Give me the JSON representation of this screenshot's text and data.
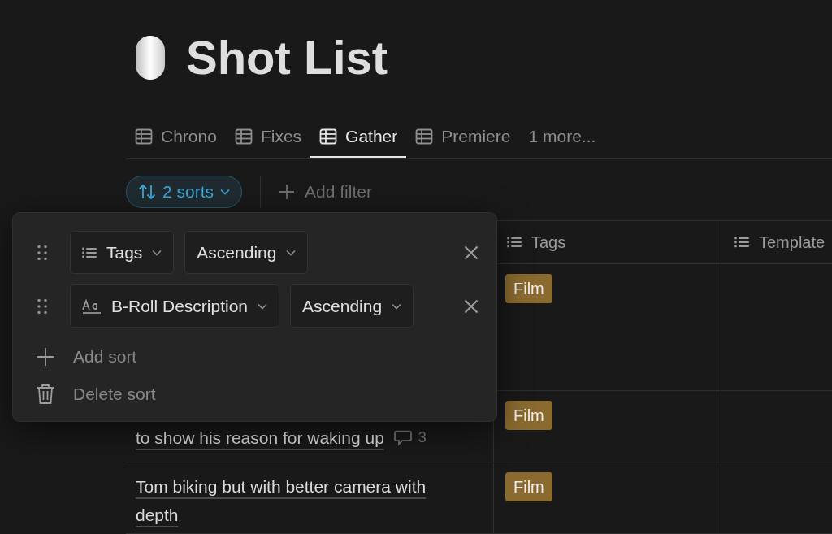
{
  "page": {
    "title": "Shot List"
  },
  "tabs": [
    {
      "label": "Chrono",
      "selected": false,
      "kind": "table"
    },
    {
      "label": "Fixes",
      "selected": false,
      "kind": "table"
    },
    {
      "label": "Gather",
      "selected": true,
      "kind": "table"
    },
    {
      "label": "Premiere",
      "selected": false,
      "kind": "table"
    },
    {
      "label": "1 more...",
      "selected": false,
      "kind": "more"
    }
  ],
  "toolbar": {
    "sort_button": "2 sorts",
    "add_filter": "Add filter"
  },
  "table": {
    "columns": [
      {
        "label": "Tags"
      },
      {
        "label": "Template"
      }
    ],
    "rows": [
      {
        "tag": "Film"
      },
      {
        "name": "to show his reason for waking up",
        "comments": "3",
        "tag": "Film"
      },
      {
        "name": "Tom biking but with better camera with depth",
        "tag": "Film"
      }
    ]
  },
  "sort_popover": {
    "sorts": [
      {
        "property": "Tags",
        "kind": "list",
        "direction": "Ascending"
      },
      {
        "property": "B-Roll Description",
        "kind": "text",
        "direction": "Ascending"
      }
    ],
    "add_sort": "Add sort",
    "delete_sort": "Delete sort"
  }
}
